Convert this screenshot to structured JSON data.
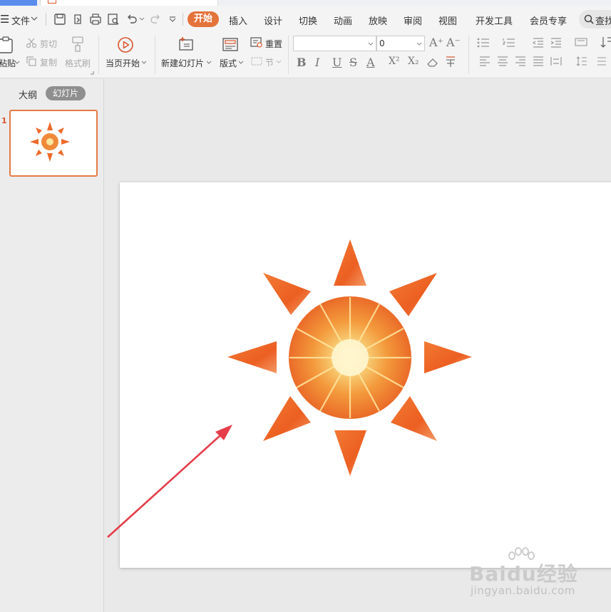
{
  "menubar": {
    "file": "文件",
    "tabs": [
      "开始",
      "插入",
      "设计",
      "切换",
      "动画",
      "放映",
      "审阅",
      "视图",
      "开发工具",
      "会员专享"
    ],
    "search": "查找"
  },
  "ribbon": {
    "paste": "粘贴",
    "cut": "剪切",
    "copy": "复制",
    "format_painter": "格式刷",
    "play_current": "当页开始",
    "new_slide": "新建幻灯片",
    "layout": "版式",
    "reset": "重置",
    "section": "节",
    "font_size": "0"
  },
  "sidebar": {
    "outline_tab": "大纲",
    "slides_tab": "幻灯片",
    "slide_number": "1"
  },
  "watermark": {
    "brand": "Baidu经验",
    "url": "jingyan.baidu.com"
  },
  "colors": {
    "accent": "#e4733b",
    "sun_orange": "#ee6a2a",
    "arrow": "#e53e4a"
  }
}
